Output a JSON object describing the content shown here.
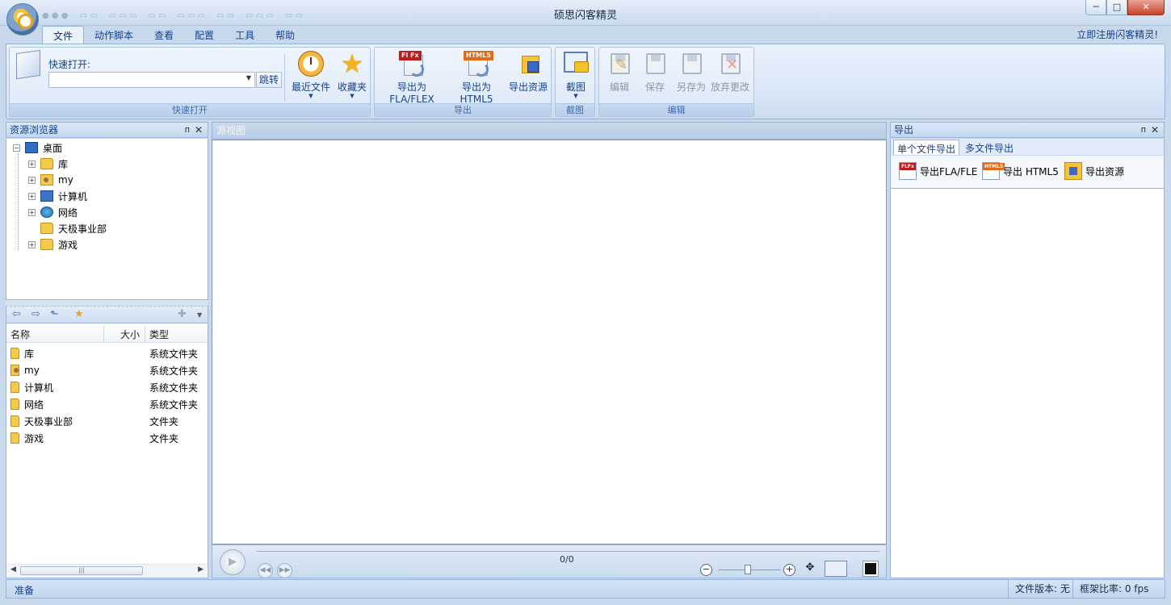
{
  "window": {
    "title": "硕思闪客精灵",
    "min": "─",
    "max": "□",
    "close": "✕"
  },
  "menu": {
    "tabs": [
      "文件",
      "动作脚本",
      "查看",
      "配置",
      "工具",
      "帮助"
    ],
    "register": "立即注册闪客精灵!"
  },
  "ribbon": {
    "quick_open": {
      "label": "快速打开:",
      "value": "",
      "jump": "跳转",
      "recent": "最近文件",
      "favorites": "收藏夹",
      "group": "快速打开"
    },
    "export": {
      "fla": "导出为FLA/FLEX",
      "html5": "导出为HTML5",
      "resources": "导出资源",
      "group": "导出",
      "fl_badge": "Fl Fx",
      "html_badge": "HTML5"
    },
    "screenshot": {
      "label": "截图",
      "group": "截图"
    },
    "edit": {
      "edit": "编辑",
      "save": "保存",
      "save_as": "另存为",
      "discard": "放弃更改",
      "group": "编辑"
    }
  },
  "explorer": {
    "title": "资源浏览器",
    "pin": "ᴨ",
    "close": "✕",
    "tree": [
      {
        "label": "桌面",
        "icon": "desktop-icon"
      },
      {
        "label": "库",
        "icon": "library-folder-icon"
      },
      {
        "label": "my",
        "icon": "user-folder-icon"
      },
      {
        "label": "计算机",
        "icon": "computer-icon"
      },
      {
        "label": "网络",
        "icon": "network-icon"
      },
      {
        "label": "天极事业部",
        "icon": "folder-icon"
      },
      {
        "label": "游戏",
        "icon": "folder-icon"
      }
    ],
    "columns": {
      "name": "名称",
      "size": "大小",
      "type": "类型"
    },
    "files": [
      {
        "name": "库",
        "type": "系统文件夹"
      },
      {
        "name": "my",
        "type": "系统文件夹"
      },
      {
        "name": "计算机",
        "type": "系统文件夹"
      },
      {
        "name": "网络",
        "type": "系统文件夹"
      },
      {
        "name": "天极事业部",
        "type": "文件夹"
      },
      {
        "name": "游戏",
        "type": "文件夹"
      }
    ]
  },
  "source_view": {
    "title": "源视图",
    "frame_counter": "0/0"
  },
  "export_panel": {
    "title": "导出",
    "tabs": [
      "单个文件导出",
      "多文件导出"
    ],
    "tools": [
      "导出FLA/FLE",
      "导出 HTML5",
      "导出资源"
    ],
    "fl_badge": "FLFx",
    "html_badge": "HTML5"
  },
  "status": {
    "left": "准备",
    "file_version": "文件版本: 无",
    "frame_rate": "框架比率: 0 fps"
  }
}
